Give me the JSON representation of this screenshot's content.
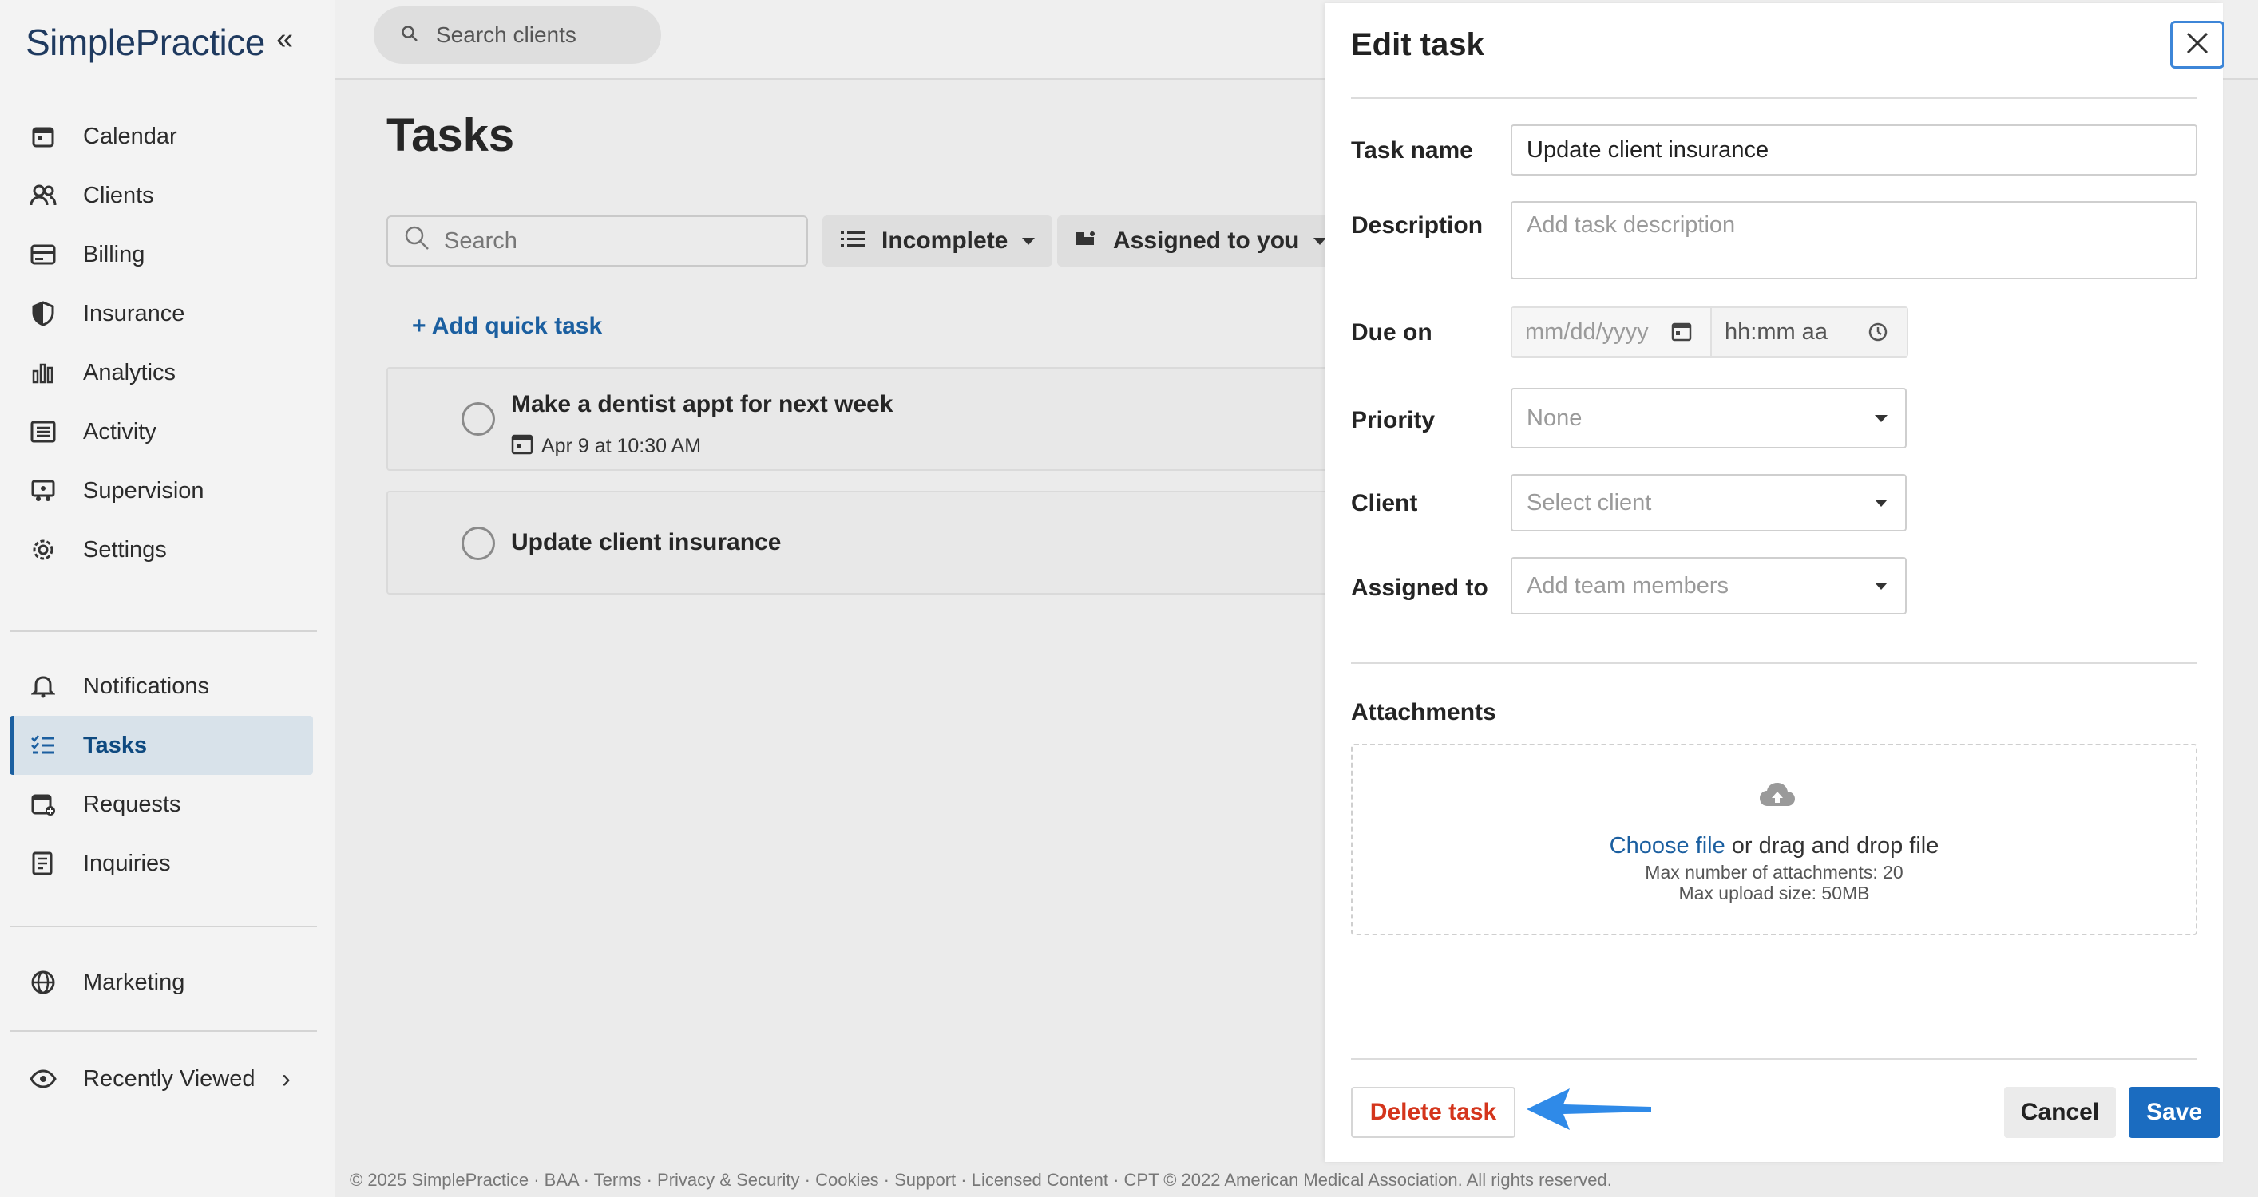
{
  "app": {
    "logo_text": "SimplePractice"
  },
  "sidebar": {
    "items_primary": [
      {
        "label": "Calendar",
        "icon": "calendar-icon"
      },
      {
        "label": "Clients",
        "icon": "users-icon"
      },
      {
        "label": "Billing",
        "icon": "credit-card-icon"
      },
      {
        "label": "Insurance",
        "icon": "shield-icon"
      },
      {
        "label": "Analytics",
        "icon": "bar-chart-icon"
      },
      {
        "label": "Activity",
        "icon": "list-icon"
      },
      {
        "label": "Supervision",
        "icon": "supervision-icon"
      },
      {
        "label": "Settings",
        "icon": "gear-icon"
      }
    ],
    "items_secondary": [
      {
        "label": "Notifications",
        "icon": "bell-icon"
      },
      {
        "label": "Tasks",
        "icon": "tasks-icon",
        "active": true
      },
      {
        "label": "Requests",
        "icon": "calendar-plus-icon"
      },
      {
        "label": "Inquiries",
        "icon": "inquiries-icon"
      }
    ],
    "marketing": {
      "label": "Marketing",
      "icon": "globe-icon"
    },
    "recently_viewed": {
      "label": "Recently Viewed",
      "icon": "eye-icon"
    }
  },
  "topbar": {
    "search_placeholder": "Search clients"
  },
  "main": {
    "title": "Tasks",
    "search_placeholder": "Search",
    "status_filter": "Incomplete",
    "assignee_filter": "Assigned to you",
    "add_quick_task": "+ Add quick task",
    "tasks": [
      {
        "name": "Make a dentist appt for next week",
        "due": "Apr 9 at 10:30 AM"
      },
      {
        "name": "Update client insurance",
        "due": ""
      }
    ]
  },
  "edit_panel": {
    "title": "Edit task",
    "task_name_label": "Task name",
    "task_name_value": "Update client insurance",
    "description_label": "Description",
    "description_placeholder": "Add task description",
    "due_label": "Due on",
    "date_placeholder": "mm/dd/yyyy",
    "time_placeholder": "hh:mm aa",
    "priority_label": "Priority",
    "priority_value": "None",
    "client_label": "Client",
    "client_placeholder": "Select client",
    "assigned_label": "Assigned to",
    "assigned_placeholder": "Add team members",
    "attachments_label": "Attachments",
    "choose_file": "Choose file",
    "drag_text": " or drag and drop file",
    "max_attachments": "Max number of attachments: 20",
    "max_upload": "Max upload size: 50MB",
    "delete_label": "Delete task",
    "cancel_label": "Cancel",
    "save_label": "Save"
  },
  "footer": {
    "text": "© 2025 SimplePractice · BAA · Terms · Privacy & Security · Cookies · Support · Licensed Content · CPT © 2022 American Medical Association. All rights reserved."
  },
  "colors": {
    "accent": "#1b6cc0",
    "danger": "#d4351c",
    "active_nav_bg": "#d8e2ea",
    "annotation_arrow": "#2f8ae8"
  }
}
